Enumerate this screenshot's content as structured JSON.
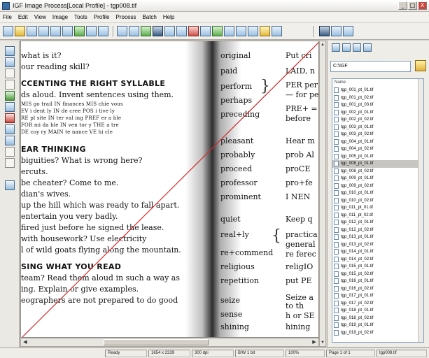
{
  "window": {
    "title": "IGF Image Process[Local Profile] - tgp008.tif",
    "controls": [
      "_",
      "□",
      "X"
    ]
  },
  "menu": [
    "File",
    "Edit",
    "View",
    "Image",
    "Tools",
    "Profile",
    "Process",
    "Batch",
    "Help"
  ],
  "toolbar": {
    "icons": [
      "open-icon",
      "save-icon",
      "print-icon",
      "scan-icon",
      "copy-icon",
      "paste-icon",
      "undo-icon",
      "redo-icon",
      "crop-icon",
      "rotate-icon",
      "deskew-icon",
      "despeckle-icon",
      "invert-icon",
      "threshold-icon",
      "zoom-in-icon",
      "zoom-out-icon",
      "fit-icon",
      "grid-icon",
      "page-icon",
      "info-icon",
      "settings-icon"
    ]
  },
  "document": {
    "left_column": [
      "what is it?",
      "our reading skill?",
      "CCENTING THE RIGHT SYLLABLE",
      "ds aloud. Invent sentences using them.",
      "EAR THINKING",
      "biguities? What is wrong here?",
      "ercuts.",
      "be cheater? Come to me.",
      "dian's wives.",
      "up the hill which was ready to fall apart.",
      "entertain you very badly.",
      "fired just before he signed the lease.",
      "with housework? Use electricity",
      "l of wild goats flying along the mountain.",
      "SING WHAT YOU READ",
      "team? Read them aloud in such a way as",
      "ing. Explain or give examples.",
      "eographers are not prepared to do good"
    ],
    "table_rows": [
      "MIS go trail    IN finances    MIS chie vous",
      "EV i dent ly    IN de cree     POS i tive ly",
      "RE pl site      IN ter val ing PREF er a ble",
      "FOR mi da ble   IN ven tor y   THE a tre",
      "DE coy ry       MAIN te nance  VE hi cle"
    ],
    "middle_column": [
      "original",
      "paid",
      "perform",
      "perhaps",
      "preceding",
      "pleasant",
      "probably",
      "proceed",
      "professor",
      "prominent",
      "quiet",
      "real+ly",
      "re+commend",
      "religious",
      "repetition",
      "seize",
      "sense",
      "shining"
    ],
    "right_column": [
      "Put cri",
      "LAID, n",
      "PER per",
      "— for pe",
      "PRE+ =",
      "before",
      "Hear m",
      "prob Al",
      "proCE",
      "pro+fe",
      "I NEN",
      "Keep q",
      "practica",
      "general",
      "re ferec",
      "religIO",
      "put PE",
      "Seize a",
      "to th",
      "h or SE",
      "hining"
    ]
  },
  "side_panel": {
    "path": "C:\\IGF",
    "list_header": "Name",
    "files": [
      "tgp_001_pt_01.tif",
      "tgp_001_pt_02.tif",
      "tgp_001_pt_03.tif",
      "tgp_002_pt_01.tif",
      "tgp_002_pt_02.tif",
      "tgp_003_pt_01.tif",
      "tgp_003_pt_02.tif",
      "tgp_004_pt_01.tif",
      "tgp_004_pt_02.tif",
      "tgp_005_pt_01.tif",
      "tgp_008_pt_01.tif",
      "tgp_008_pt_02.tif",
      "tgp_009_pt_01.tif",
      "tgp_009_pt_02.tif",
      "tgp_010_pt_01.tif",
      "tgp_010_pt_02.tif",
      "tgp_011_pt_01.tif",
      "tgp_011_pt_02.tif",
      "tgp_012_pt_01.tif",
      "tgp_012_pt_02.tif",
      "tgp_013_pt_01.tif",
      "tgp_013_pt_02.tif",
      "tgp_014_pt_01.tif",
      "tgp_014_pt_02.tif",
      "tgp_015_pt_01.tif",
      "tgp_015_pt_02.tif",
      "tgp_016_pt_01.tif",
      "tgp_016_pt_02.tif",
      "tgp_017_pt_01.tif",
      "tgp_017_pt_02.tif",
      "tgp_018_pt_01.tif",
      "tgp_018_pt_02.tif",
      "tgp_019_pt_01.tif",
      "tgp_019_pt_02.tif"
    ],
    "selected_index": 10
  },
  "status": {
    "cells": [
      "Ready",
      "1654 x 2339",
      "300 dpi",
      "B/W 1 bit",
      "100%",
      "Page 1 of 1",
      "tgp008.tif"
    ]
  },
  "colors": {
    "window_bg": "#d4d0c8",
    "diagonal_line": "#d12a2a",
    "selection": "#c8c6c2"
  }
}
